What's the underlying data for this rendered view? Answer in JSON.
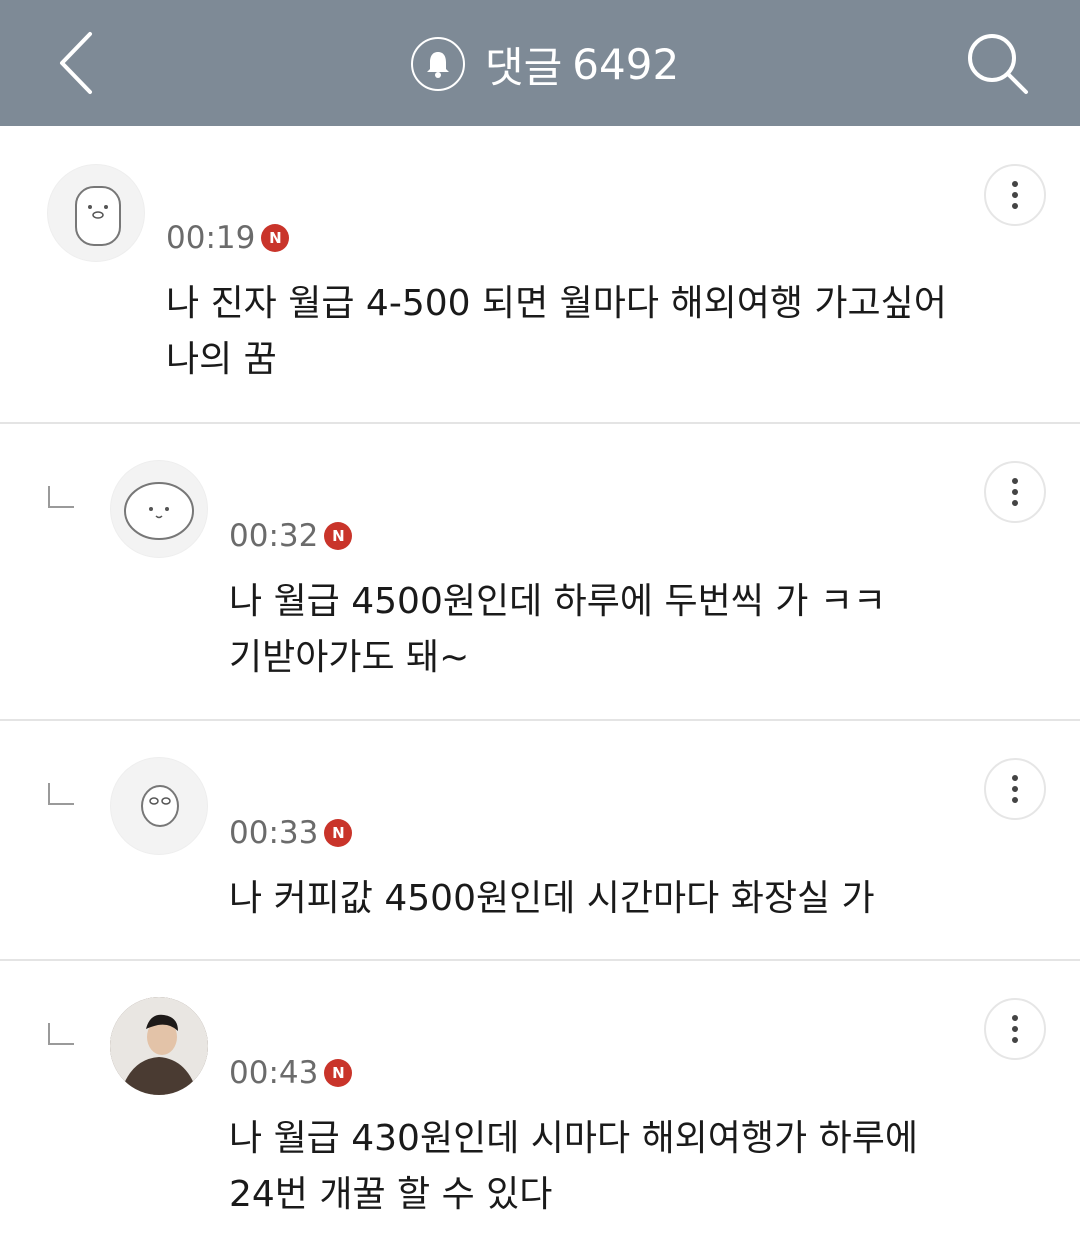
{
  "header": {
    "back_icon": "chevron-left-icon",
    "bell_icon": "bell-icon",
    "search_icon": "search-icon",
    "title": "댓글",
    "count": "6492",
    "background": "#7e8a96"
  },
  "comments": [
    {
      "is_reply": false,
      "avatar": "sticker-avatar",
      "time": "00:19",
      "badge": "N",
      "lines": [
        "나 진자 월급 4-500 되면 월마다 해외여행 가고싶어",
        "나의 꿈"
      ]
    },
    {
      "is_reply": true,
      "avatar": "sticker-avatar",
      "time": "00:32",
      "badge": "N",
      "lines": [
        "나 월급 4500원인데 하루에 두번씩 가 ㅋㅋ",
        "기받아가도 돼~"
      ]
    },
    {
      "is_reply": true,
      "avatar": "sticker-avatar",
      "time": "00:33",
      "badge": "N",
      "lines": [
        "나 커피값 4500원인데 시간마다 화장실 가"
      ]
    },
    {
      "is_reply": true,
      "avatar": "photo-avatar",
      "time": "00:43",
      "badge": "N",
      "lines": [
        "나 월급 430원인데 시마다 해외여행가 하루에",
        "24번 개꿀 할 수 있다"
      ]
    }
  ],
  "colors": {
    "badge": "#c9342a",
    "time": "#6b6b6b",
    "divider": "#e4e4e4"
  }
}
